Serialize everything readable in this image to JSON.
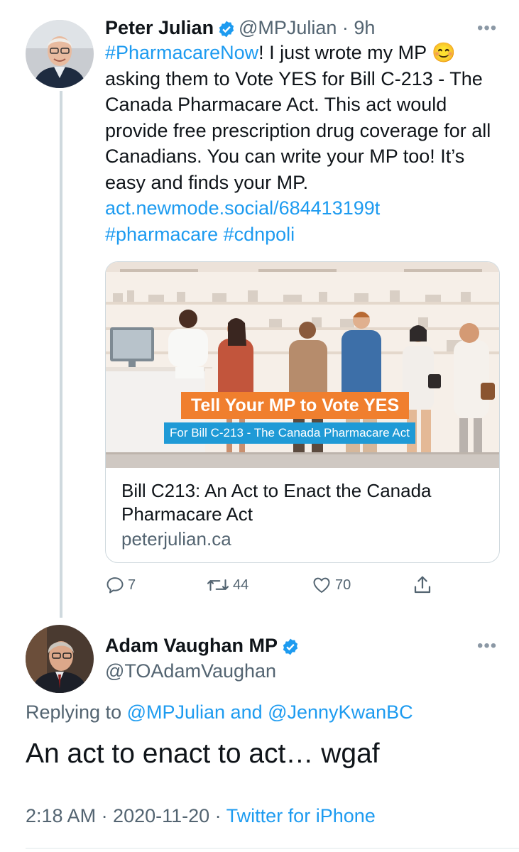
{
  "tweet1": {
    "author_name": "Peter Julian",
    "handle_time": "@MPJulian · 9h",
    "text_hashtag_lead": "#PharmacareNow",
    "text_body": "! I just wrote my MP 😊 asking them to Vote YES for Bill C-213 - The Canada Pharmacare Act. This act would provide free prescription drug coverage for all Canadians. You can write your MP too! It’s easy and finds your MP.",
    "text_link": "act.newmode.social/684413199t",
    "text_hashtags": "#pharmacare #cdnpoli",
    "card": {
      "banner_title": "Tell Your MP to Vote YES",
      "banner_subtitle": "For Bill C-213 - The Canada Pharmacare Act",
      "title": "Bill C213: An Act to Enact the Canada Pharmacare Act",
      "domain": "peterjulian.ca"
    },
    "actions": {
      "replies": "7",
      "retweets": "44",
      "likes": "70"
    }
  },
  "tweet2": {
    "author_name": "Adam Vaughan MP",
    "handle": "@TOAdamVaughan",
    "replying_prefix": "Replying to ",
    "replying_users": "@MPJulian and @JennyKwanBC",
    "text": "An act to enact to act… wgaf",
    "time": "2:18 AM · 2020-11-20 · ",
    "client": "Twitter for iPhone"
  },
  "colors": {
    "accent_blue": "#1d9bf0",
    "secondary_text": "#536471",
    "banner_orange": "#f07f2e",
    "banner_blue": "#1f9ad6"
  },
  "icons": [
    "more-icon",
    "verified-icon",
    "reply-icon",
    "retweet-icon",
    "like-icon",
    "share-icon"
  ]
}
